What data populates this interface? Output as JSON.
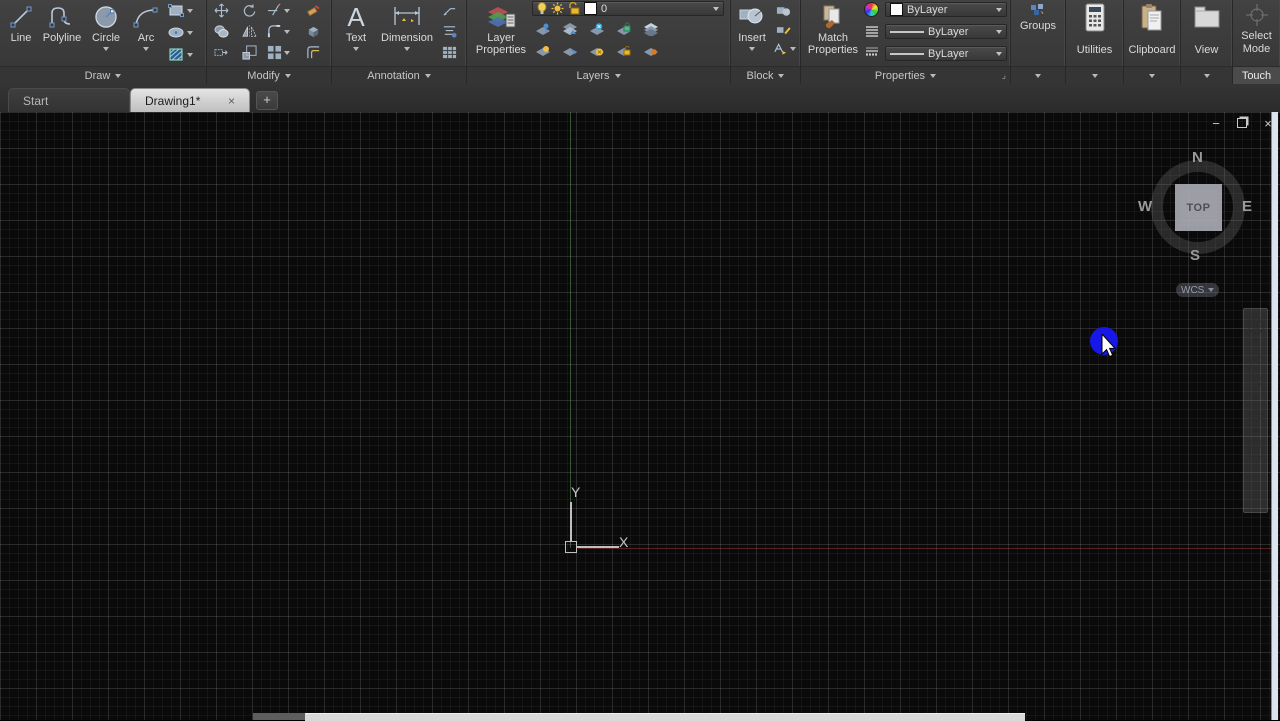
{
  "colors": {
    "touch_indicator": "#1717e8",
    "ribbon_bg": "#3a3a3a",
    "canvas_bg": "#0a0a0b",
    "active_tab": "#d4d4d4",
    "axis_green": "#5f965f",
    "axis_red": "#a03c37"
  },
  "ribbon": {
    "draw": {
      "label": "Draw",
      "line": "Line",
      "polyline": "Polyline",
      "circle": "Circle",
      "arc": "Arc"
    },
    "modify": {
      "label": "Modify"
    },
    "annotation": {
      "label": "Annotation",
      "text": "Text",
      "dimension": "Dimension"
    },
    "layers": {
      "label": "Layers",
      "layer_properties": "Layer Properties",
      "current_layer": "0"
    },
    "block": {
      "label": "Block",
      "insert": "Insert"
    },
    "properties": {
      "label": "Properties",
      "match_properties": "Match Properties",
      "color": "ByLayer",
      "linetype": "ByLayer",
      "lineweight": "ByLayer"
    },
    "groups": {
      "label": "Groups"
    },
    "utilities": {
      "label": "Utilities"
    },
    "clipboard": {
      "label": "Clipboard"
    },
    "view": {
      "label": "View"
    },
    "select_mode": {
      "line1": "Select",
      "line2": "Mode",
      "panel_label": "Touch"
    }
  },
  "tabs": {
    "start": "Start",
    "drawing": "Drawing1*",
    "close_glyph": "×",
    "new_tab_glyph": "+"
  },
  "window_controls": {
    "minimize_glyph": "−",
    "close_glyph": "×"
  },
  "canvas": {
    "viewcube": {
      "north": "N",
      "south": "S",
      "east": "E",
      "west": "W",
      "face": "TOP",
      "wcs": "WCS"
    },
    "ucs": {
      "x_label": "X",
      "y_label": "Y"
    }
  }
}
